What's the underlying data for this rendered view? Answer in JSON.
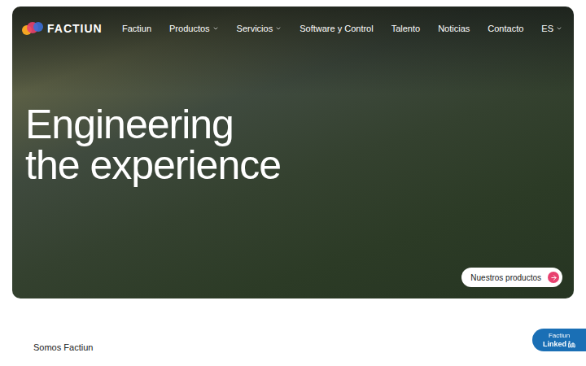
{
  "logo": {
    "text": "FACTIUN"
  },
  "nav": [
    {
      "label": "Factiun",
      "dropdown": false
    },
    {
      "label": "Productos",
      "dropdown": true
    },
    {
      "label": "Servicios",
      "dropdown": true
    },
    {
      "label": "Software y Control",
      "dropdown": false
    },
    {
      "label": "Talento",
      "dropdown": false
    },
    {
      "label": "Noticias",
      "dropdown": false
    },
    {
      "label": "Contacto",
      "dropdown": false
    },
    {
      "label": "ES",
      "dropdown": true
    }
  ],
  "hero": {
    "title": [
      "Engineering",
      "the experience"
    ],
    "cta": "Nuestros productos"
  },
  "intro": {
    "eyebrow": "Somos Factiun"
  },
  "linkedin_badge": {
    "name": "Factiun",
    "network": "Linked"
  }
}
